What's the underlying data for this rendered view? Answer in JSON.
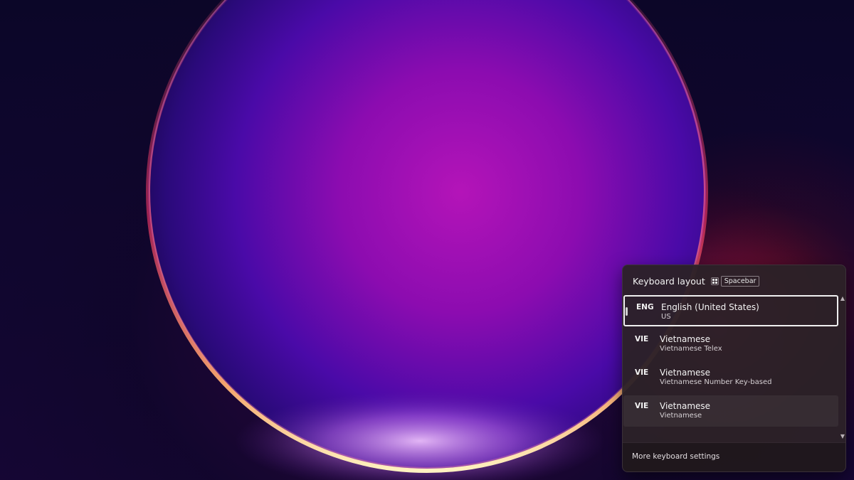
{
  "flyout": {
    "title": "Keyboard layout",
    "shortcut_key_icon": "windows-logo-icon",
    "shortcut_key": "Spacebar",
    "items": [
      {
        "code": "ENG",
        "language": "English (United States)",
        "layout": "US",
        "state": "selected"
      },
      {
        "code": "VIE",
        "language": "Vietnamese",
        "layout": "Vietnamese Telex",
        "state": "normal"
      },
      {
        "code": "VIE",
        "language": "Vietnamese",
        "layout": "Vietnamese Number Key-based",
        "state": "normal"
      },
      {
        "code": "VIE",
        "language": "Vietnamese",
        "layout": "Vietnamese",
        "state": "hovered"
      }
    ],
    "scroll_up_icon": "▲",
    "scroll_down_icon": "▼",
    "footer_link": "More keyboard settings"
  },
  "colors": {
    "flyout_bg": "#2c2128",
    "selected_border": "#f0f0f0"
  }
}
